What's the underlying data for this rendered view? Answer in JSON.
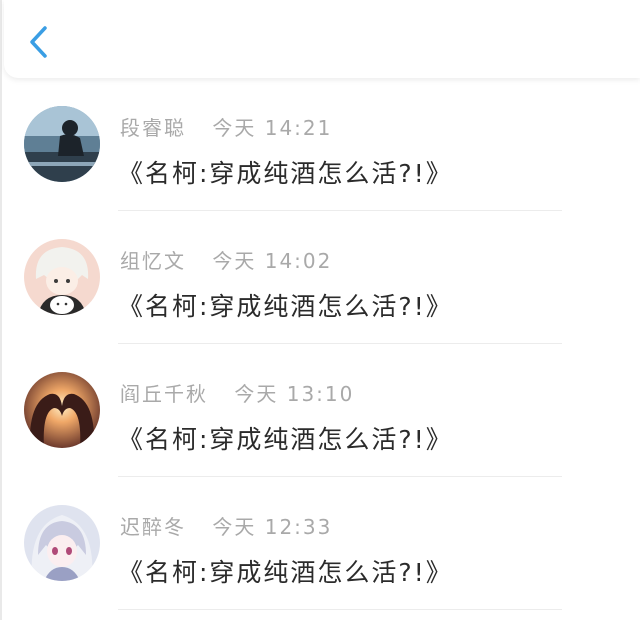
{
  "header": {
    "back_icon": "chevron-left-icon",
    "accent": "#3a9ee4"
  },
  "items": [
    {
      "name": "段睿聪",
      "time": "今天 14:21",
      "message": "《名柯:穿成纯酒怎么活?!》",
      "avatar_icon": "silhouette-landscape-avatar"
    },
    {
      "name": "组忆文",
      "time": "今天 14:02",
      "message": "《名柯:穿成纯酒怎么活?!》",
      "avatar_icon": "anime-boy-cat-avatar"
    },
    {
      "name": "阎丘千秋",
      "time": "今天 13:10",
      "message": "《名柯:穿成纯酒怎么活?!》",
      "avatar_icon": "heart-hands-sunset-avatar"
    },
    {
      "name": "迟醉冬",
      "time": "今天 12:33",
      "message": "《名柯:穿成纯酒怎么活?!》",
      "avatar_icon": "anime-girl-avatar"
    }
  ]
}
